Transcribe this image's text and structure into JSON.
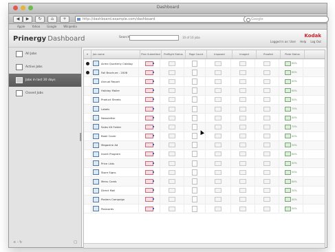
{
  "window": {
    "title": "Dashboard"
  },
  "browser": {
    "url": "http://dashboard.example.com/dashboard",
    "search_placeholder": "Google",
    "bookmarks": [
      "Apple",
      "Yahoo",
      "Google",
      "Wikipedia"
    ]
  },
  "app": {
    "brand_bold": "Prinergy",
    "brand_light": "Dashboard",
    "search_label": "Search:",
    "count_label": "10 of 10 jobs",
    "vendor": "Kodak",
    "user_links": [
      "Logged in as: User",
      "Help",
      "Log Out"
    ]
  },
  "sidebar": {
    "items": [
      {
        "label": "All Jobs"
      },
      {
        "label": "Active Jobs"
      },
      {
        "label": "Jobs in last 30 days"
      },
      {
        "label": "Closed Jobs"
      }
    ],
    "selected_index": 2,
    "footer_left": "+ -  ↻",
    "footer_right": "□"
  },
  "table": {
    "columns": [
      "Job name",
      "Plan Submitted",
      "Preflight Status",
      "Page Count",
      "Imposed",
      "Imaged",
      "Proofed",
      "Plate Status"
    ],
    "rows": [
      {
        "name": "Acme Quarterly Catalog",
        "pct": "60%",
        "bullet": true
      },
      {
        "name": "Fall Brochure - 2008",
        "pct": "80%",
        "bullet": true
      },
      {
        "name": "Annual Report",
        "pct": "40%",
        "bullet": false
      },
      {
        "name": "Holiday Mailer",
        "pct": "60%",
        "bullet": false
      },
      {
        "name": "Product Sheets",
        "pct": "50%",
        "bullet": false
      },
      {
        "name": "Labels",
        "pct": "70%",
        "bullet": false
      },
      {
        "name": "Newsletter",
        "pct": "40%",
        "bullet": false
      },
      {
        "name": "Sales Kit Folder",
        "pct": "70%",
        "bullet": false
      },
      {
        "name": "Book Cover",
        "pct": "40%",
        "bullet": false
      },
      {
        "name": "Magazine Ad",
        "pct": "50%",
        "bullet": false
      },
      {
        "name": "Insert Program",
        "pct": "60%",
        "bullet": false
      },
      {
        "name": "Price Lists",
        "pct": "40%",
        "bullet": false
      },
      {
        "name": "Store Signs",
        "pct": "50%",
        "bullet": false
      },
      {
        "name": "Menu Cards",
        "pct": "60%",
        "bullet": false
      },
      {
        "name": "Direct Mail",
        "pct": "30%",
        "bullet": false
      },
      {
        "name": "Posters Campaign",
        "pct": "40%",
        "bullet": false
      },
      {
        "name": "Postcards",
        "pct": "50%",
        "bullet": false
      }
    ]
  },
  "colors": {
    "accent": "#c9202b",
    "selection": "#636363"
  }
}
